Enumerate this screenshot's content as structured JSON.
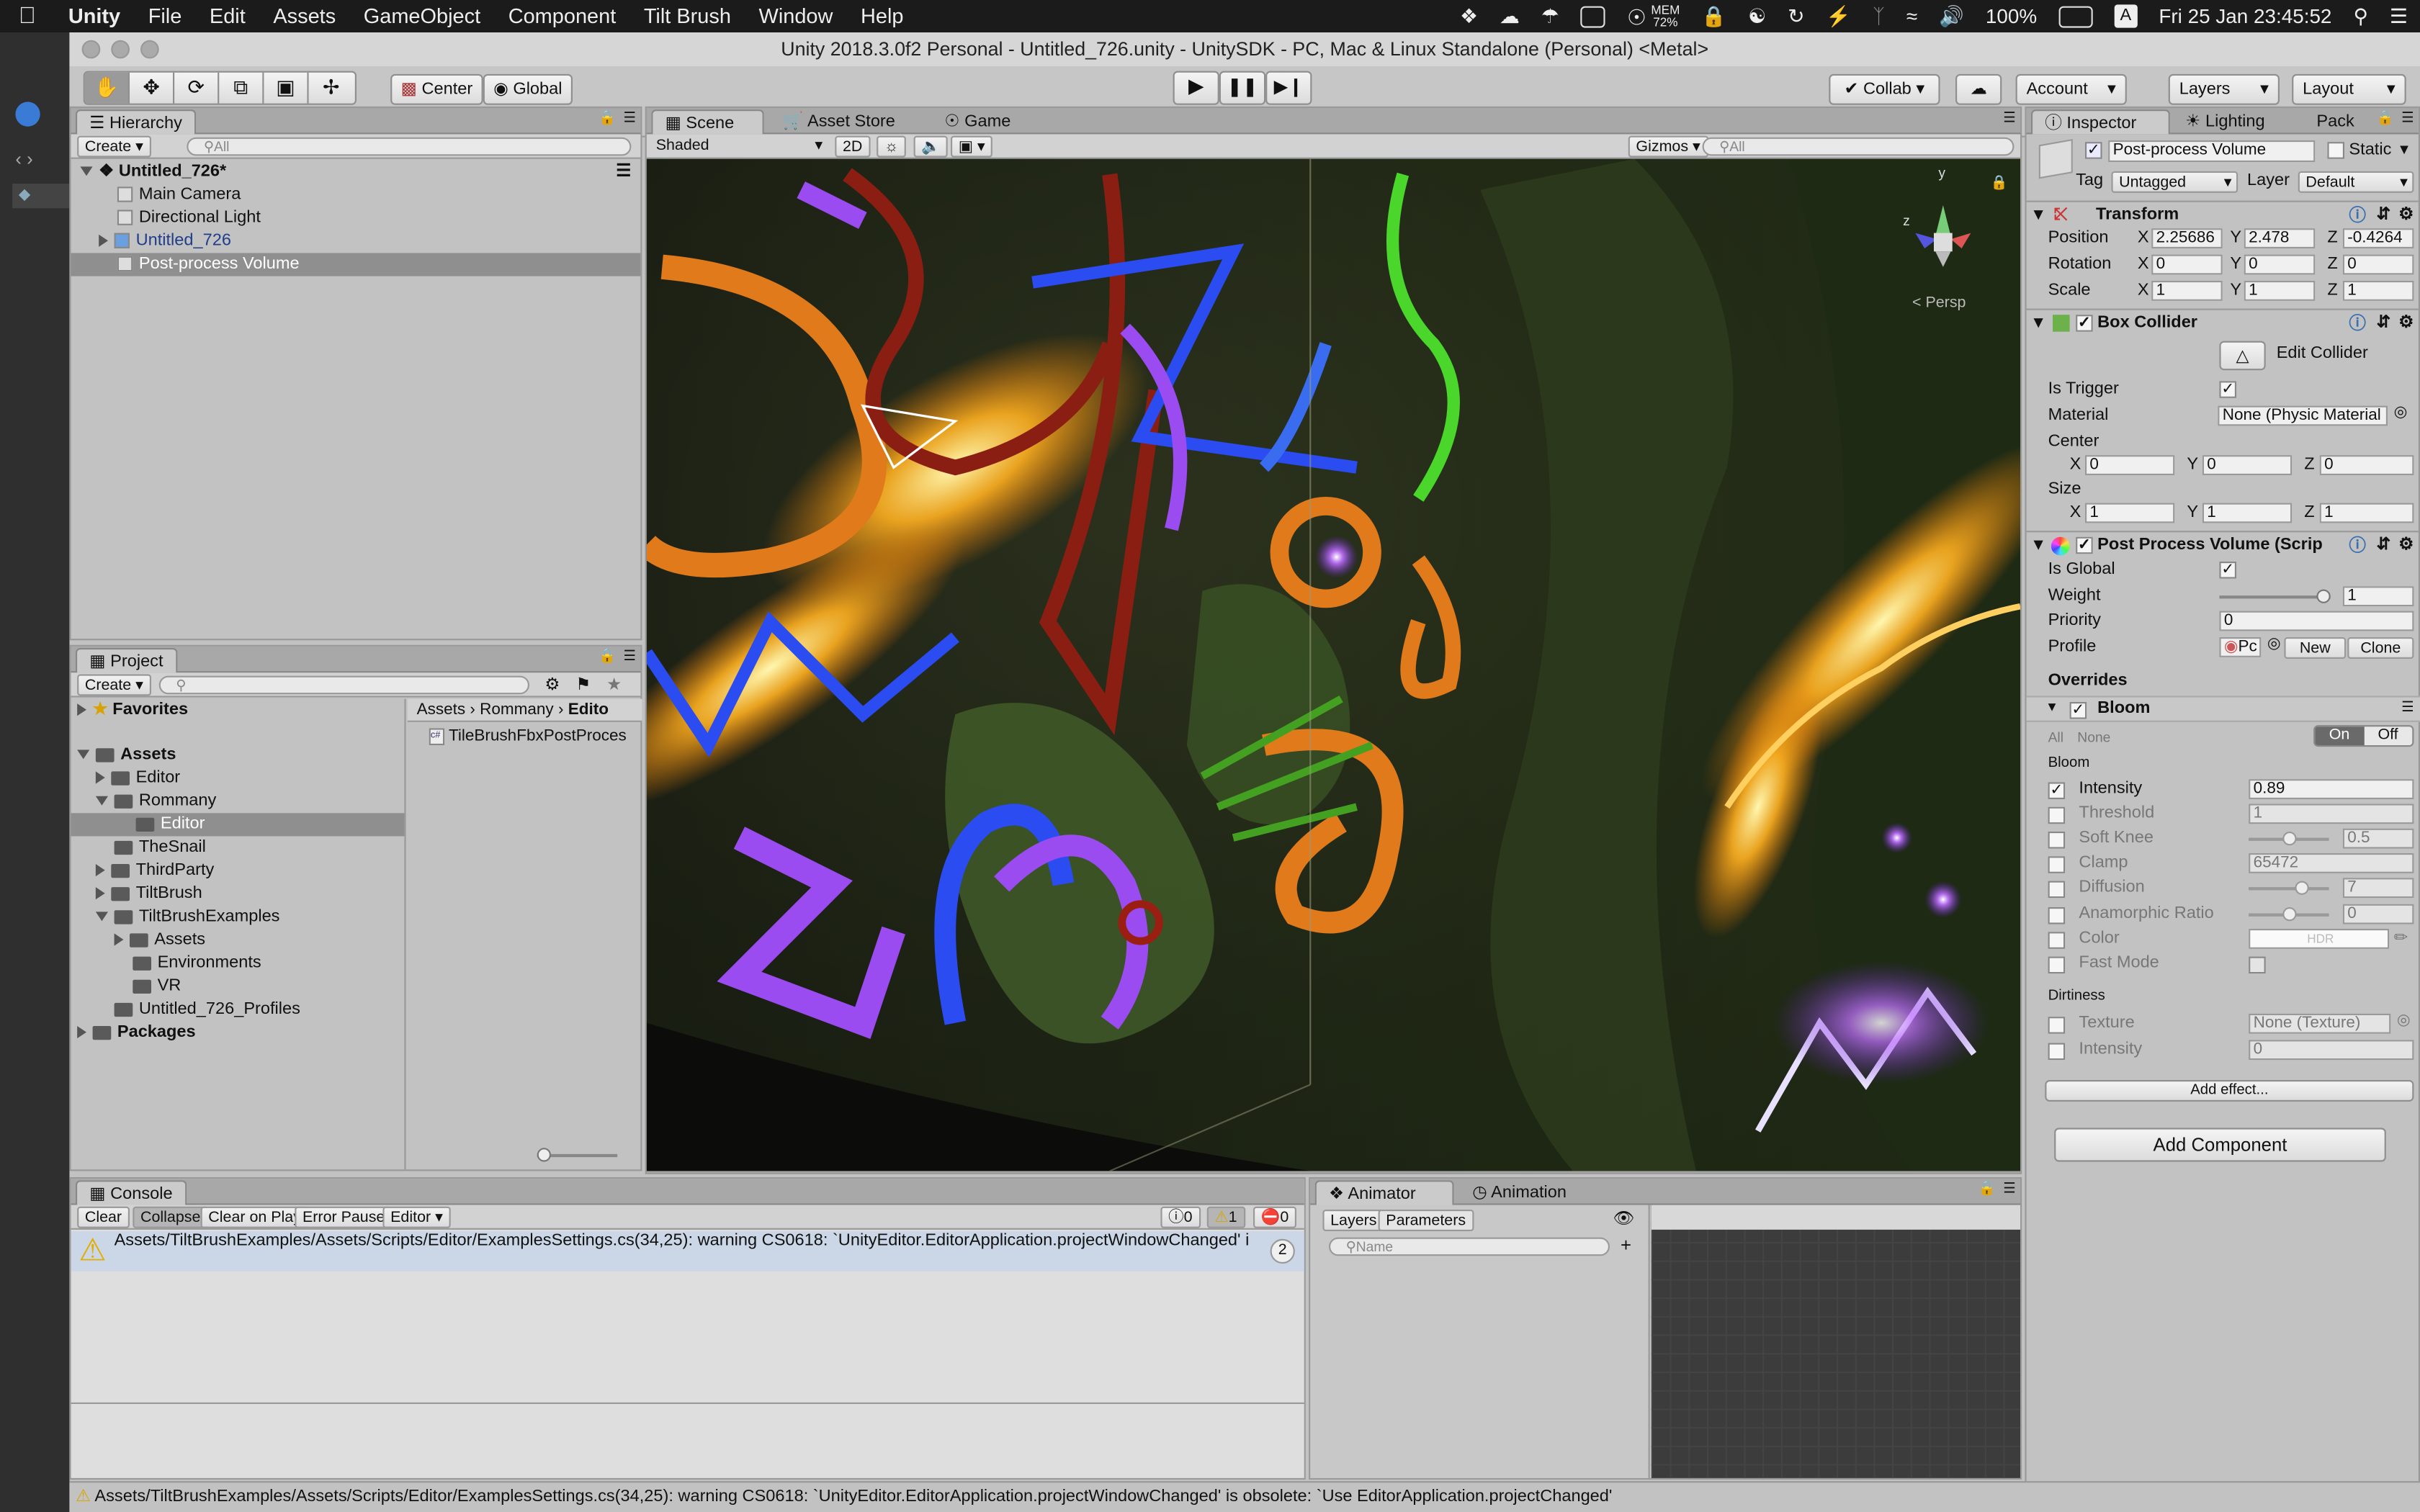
{
  "menubar": {
    "apple": "",
    "items": [
      "Unity",
      "File",
      "Edit",
      "Assets",
      "GameObject",
      "Component",
      "Tilt Brush",
      "Window",
      "Help"
    ],
    "mem": "MEM",
    "mem_pct": "72%",
    "battery": "100%",
    "user_initial": "A",
    "clock": "Fri 25 Jan  23:45:52"
  },
  "window": {
    "title": "Unity 2018.3.0f2 Personal - Untitled_726.unity - UnitySDK - PC, Mac & Linux Standalone (Personal) <Metal>"
  },
  "toolbar": {
    "pivot": "Center",
    "space": "Global",
    "collab": "Collab",
    "account": "Account",
    "layers": "Layers",
    "layout": "Layout"
  },
  "hierarchy": {
    "tab": "Hierarchy",
    "create": "Create",
    "search_placeholder": "All",
    "scene": "Untitled_726*",
    "items": [
      "Main Camera",
      "Directional Light",
      "Untitled_726",
      "Post-process Volume"
    ]
  },
  "project": {
    "tab": "Project",
    "create": "Create",
    "favorites": "Favorites",
    "assets": "Assets",
    "tree": [
      "Editor",
      "Rommany",
      "Editor",
      "TheSnail",
      "ThirdParty",
      "TiltBrush",
      "TiltBrushExamples",
      "Assets",
      "Environments",
      "VR",
      "Untitled_726_Profiles"
    ],
    "packages": "Packages",
    "breadcrumb": [
      "Assets",
      "Rommany",
      "Edito"
    ],
    "file": "TileBrushFbxPostProces"
  },
  "scene_view": {
    "tabs": [
      "Scene",
      "Asset Store",
      "Game"
    ],
    "shading": "Shaded",
    "mode2d": "2D",
    "gizmos": "Gizmos",
    "search_placeholder": "All",
    "persp": "< Persp",
    "axis_y": "y",
    "axis_z": "z"
  },
  "inspector": {
    "tabs": [
      "Inspector",
      "Lighting",
      "Pack"
    ],
    "object_name": "Post-process Volume",
    "static_label": "Static",
    "tag_label": "Tag",
    "tag_value": "Untagged",
    "layer_label": "Layer",
    "layer_value": "Default",
    "transform": {
      "title": "Transform",
      "position_label": "Position",
      "position": [
        "2.25686",
        "2.478",
        "-0.4264"
      ],
      "rotation_label": "Rotation",
      "rotation": [
        "0",
        "0",
        "0"
      ],
      "scale_label": "Scale",
      "scale": [
        "1",
        "1",
        "1"
      ]
    },
    "box_collider": {
      "title": "Box Collider",
      "edit_collider": "Edit Collider",
      "is_trigger": "Is Trigger",
      "material_label": "Material",
      "material_value": "None (Physic Material",
      "center_label": "Center",
      "center": [
        "0",
        "0",
        "0"
      ],
      "size_label": "Size",
      "size": [
        "1",
        "1",
        "1"
      ]
    },
    "post_process": {
      "title": "Post Process Volume (Scrip",
      "is_global": "Is Global",
      "weight_label": "Weight",
      "weight_value": "1",
      "weight_fraction": 1.0,
      "priority_label": "Priority",
      "priority_value": "0",
      "profile_label": "Profile",
      "profile_value": "Pc",
      "new_btn": "New",
      "clone_btn": "Clone",
      "overrides": "Overrides",
      "bloom": "Bloom",
      "all": "All",
      "none": "None",
      "on": "On",
      "off": "Off",
      "bloom_section": "Bloom",
      "rows": [
        {
          "label": "Intensity",
          "value": "0.89",
          "enabled": true
        },
        {
          "label": "Threshold",
          "value": "1",
          "enabled": false
        },
        {
          "label": "Soft Knee",
          "value": "0.5",
          "enabled": false
        },
        {
          "label": "Clamp",
          "value": "65472",
          "enabled": false
        },
        {
          "label": "Diffusion",
          "value": "7",
          "enabled": false
        },
        {
          "label": "Anamorphic Ratio",
          "value": "0",
          "enabled": false
        },
        {
          "label": "Color",
          "value": "HDR",
          "enabled": false
        },
        {
          "label": "Fast Mode",
          "value": "",
          "enabled": false
        }
      ],
      "dirtiness": "Dirtiness",
      "dirt_rows": [
        {
          "label": "Texture",
          "value": "None (Texture)"
        },
        {
          "label": "Intensity",
          "value": "0"
        }
      ],
      "add_effect": "Add effect..."
    },
    "add_component": "Add Component"
  },
  "console": {
    "tab": "Console",
    "buttons": [
      "Clear",
      "Collapse",
      "Clear on Play",
      "Error Pause",
      "Editor"
    ],
    "counts": [
      "0",
      "1",
      "0"
    ],
    "message": "Assets/TiltBrushExamples/Assets/Scripts/Editor/ExamplesSettings.cs(34,25): warning CS0618: `UnityEditor.EditorApplication.projectWindowChanged' is obsolete: `Use EditorApplication.projectChanged'",
    "message_short": "Assets/TiltBrushExamples/Assets/Scripts/Editor/ExamplesSettings.cs(34,25): warning CS0618: `UnityEditor.EditorApplication.projectWindowChanged' i",
    "collapse_count": "2"
  },
  "animator": {
    "tabs": [
      "Animator",
      "Animation"
    ],
    "subtabs": [
      "Layers",
      "Parameters"
    ],
    "search_placeholder": "Name"
  },
  "statusbar": {
    "message": "Assets/TiltBrushExamples/Assets/Scripts/Editor/ExamplesSettings.cs(34,25): warning CS0618: `UnityEditor.EditorApplication.projectWindowChanged' is obsolete: `Use EditorApplication.projectChanged'"
  }
}
